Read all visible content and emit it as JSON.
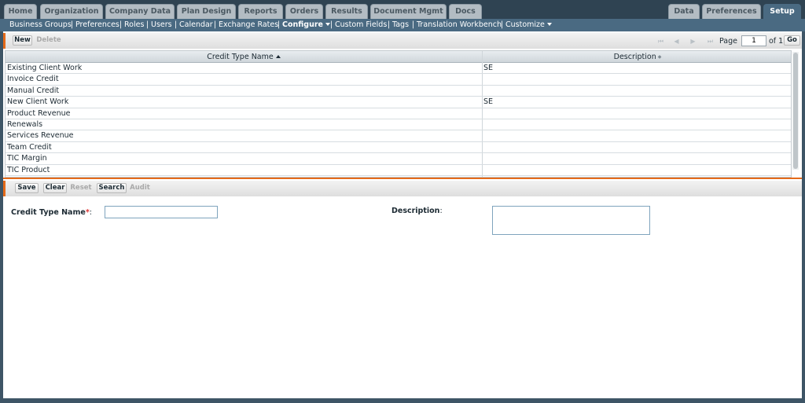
{
  "top_tabs": [
    {
      "label": "Home"
    },
    {
      "label": "Organization"
    },
    {
      "label": "Company Data"
    },
    {
      "label": "Plan Design"
    },
    {
      "label": "Reports"
    },
    {
      "label": "Orders"
    },
    {
      "label": "Results"
    },
    {
      "label": "Document Mgmt"
    },
    {
      "label": "Docs"
    }
  ],
  "right_tabs": [
    {
      "label": "Data"
    },
    {
      "label": "Preferences"
    },
    {
      "label": "Setup",
      "active": true
    }
  ],
  "subnav": {
    "items": [
      "Business Groups",
      "Preferences",
      "Roles",
      "Users",
      "Calendar",
      "Exchange Rates",
      "Configure",
      "Custom Fields",
      "Tags",
      "Translation Workbench",
      "Customize"
    ],
    "separator": "|"
  },
  "toolbar": {
    "new_label": "New",
    "delete_label": "Delete"
  },
  "pager": {
    "page_label": "Page",
    "current_page": "1",
    "of_label": "of 1",
    "go_label": "Go"
  },
  "grid": {
    "columns": [
      "Credit Type Name",
      "Description"
    ],
    "rows": [
      {
        "name": "Existing Client Work",
        "desc": "SE"
      },
      {
        "name": "Invoice Credit",
        "desc": ""
      },
      {
        "name": "Manual Credit",
        "desc": ""
      },
      {
        "name": "New Client Work",
        "desc": "SE"
      },
      {
        "name": "Product Revenue",
        "desc": ""
      },
      {
        "name": "Renewals",
        "desc": ""
      },
      {
        "name": "Services Revenue",
        "desc": ""
      },
      {
        "name": "Team Credit",
        "desc": ""
      },
      {
        "name": "TIC Margin",
        "desc": ""
      },
      {
        "name": "TIC Product",
        "desc": ""
      }
    ]
  },
  "form_toolbar": {
    "save_label": "Save",
    "clear_label": "Clear",
    "reset_label": "Reset",
    "search_label": "Search",
    "audit_label": "Audit"
  },
  "form": {
    "credit_type_label": "Credit Type Name",
    "required_mark": "*",
    "colon": ":",
    "description_label": "Description",
    "credit_type_value": "",
    "description_value": ""
  },
  "colors": {
    "accent": "#e46a1a",
    "nav": "#4a6a82",
    "background": "#3e5566"
  }
}
